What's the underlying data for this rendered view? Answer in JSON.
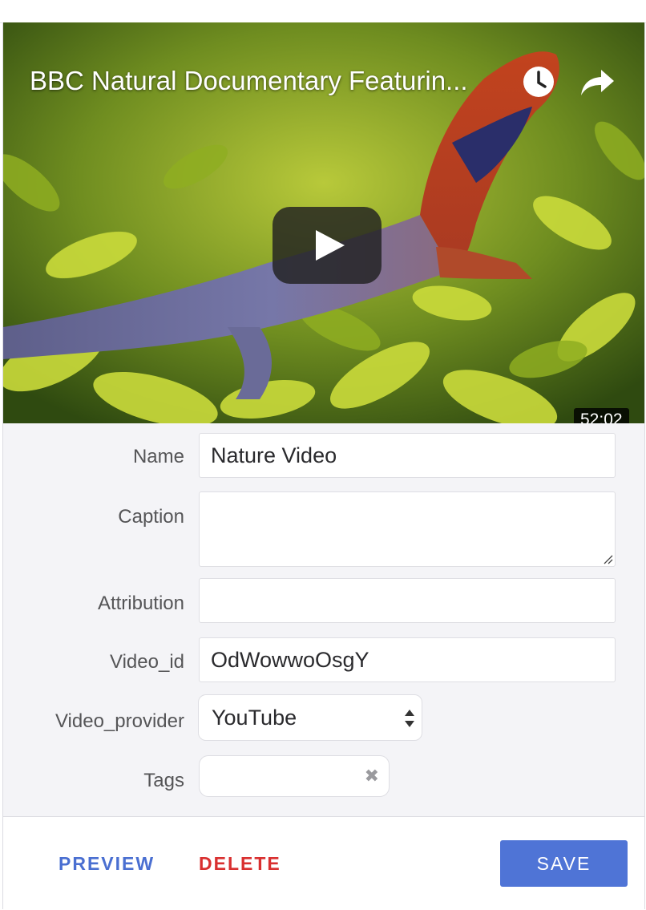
{
  "video": {
    "title": "BBC Natural Documentary Featurin...",
    "duration": "52:02",
    "icons": {
      "watch_later": "clock-icon",
      "share": "share-arrow-icon",
      "play": "play-icon"
    }
  },
  "form": {
    "name": {
      "label": "Name",
      "value": "Nature Video"
    },
    "caption": {
      "label": "Caption",
      "value": ""
    },
    "attribution": {
      "label": "Attribution",
      "value": ""
    },
    "video_id": {
      "label": "Video_id",
      "value": "OdWowwoOsgY"
    },
    "video_provider": {
      "label": "Video_provider",
      "value": "YouTube"
    },
    "tags": {
      "label": "Tags",
      "clear_icon": "✖"
    }
  },
  "footer": {
    "preview_label": "PREVIEW",
    "delete_label": "DELETE",
    "save_label": "SAVE"
  },
  "colors": {
    "preview": "#4a6fd1",
    "delete": "#d93030",
    "save_bg": "#4f74d6"
  }
}
